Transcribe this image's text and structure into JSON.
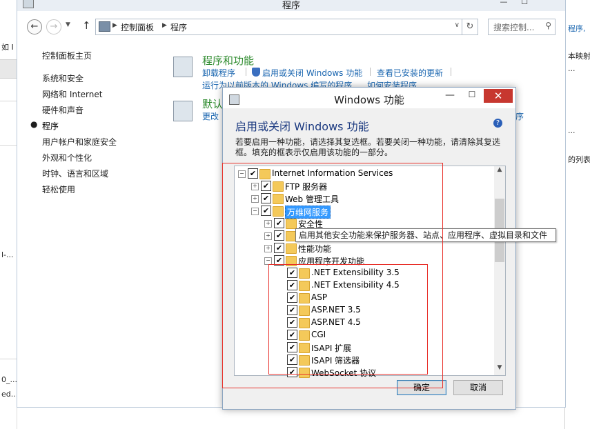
{
  "background_left": {
    "label_top": "如 I",
    "label_mid": "l-...",
    "label_low1": "0_...",
    "label_low2": "ed..."
  },
  "background_right": {
    "link1": "程序,",
    "text1": "本映射",
    "text2": "...",
    "text3": "的列表"
  },
  "control_panel": {
    "window_title": "程序",
    "address": {
      "crumbs": [
        "控制面板",
        "程序"
      ]
    },
    "search_placeholder": "搜索控制...",
    "sidebar": {
      "home": "控制面板主页",
      "items": [
        "系统和安全",
        "网络和 Internet",
        "硬件和声音",
        "程序",
        "用户帐户和家庭安全",
        "外观和个性化",
        "时钟、语言和区域",
        "轻松使用"
      ],
      "current_index": 3
    },
    "programs_section": {
      "title": "程序和功能",
      "links": [
        "卸载程序",
        "启用或关闭 Windows 功能",
        "查看已安装的更新"
      ],
      "link_row2": [
        "运行为以前版本的 Windows 编写的程序",
        "如何安装程序"
      ]
    },
    "default_section": {
      "title": "默认",
      "link": "更改",
      "right_fragment": "序"
    }
  },
  "dialog": {
    "title": "Windows 功能",
    "heading": "启用或关闭 Windows 功能",
    "description": "若要启用一种功能，请选择其复选框。若要关闭一种功能，请清除其复选框。填充的框表示仅启用该功能的一部分。",
    "tree": [
      {
        "label": "Internet Information Services",
        "level": 0,
        "expander": "−",
        "checked": true
      },
      {
        "label": "FTP 服务器",
        "level": 1,
        "expander": "+",
        "checked": true
      },
      {
        "label": "Web 管理工具",
        "level": 1,
        "expander": "+",
        "checked": true
      },
      {
        "label": "万维网服务",
        "level": 1,
        "expander": "−",
        "checked": true,
        "selected": true
      },
      {
        "label": "安全性",
        "level": 2,
        "expander": "+",
        "checked": true
      },
      {
        "label": "",
        "level": 2,
        "expander": "+",
        "checked": true
      },
      {
        "label": "性能功能",
        "level": 2,
        "expander": "+",
        "checked": true
      },
      {
        "label": "应用程序开发功能",
        "level": 2,
        "expander": "−",
        "checked": true
      },
      {
        "label": ".NET Extensibility 3.5",
        "level": 3,
        "checked": true
      },
      {
        "label": ".NET Extensibility 4.5",
        "level": 3,
        "checked": true
      },
      {
        "label": "ASP",
        "level": 3,
        "checked": true
      },
      {
        "label": "ASP.NET 3.5",
        "level": 3,
        "checked": true
      },
      {
        "label": "ASP.NET 4.5",
        "level": 3,
        "checked": true
      },
      {
        "label": "CGI",
        "level": 3,
        "checked": true
      },
      {
        "label": "ISAPI 扩展",
        "level": 3,
        "checked": true
      },
      {
        "label": "ISAPI 筛选器",
        "level": 3,
        "checked": true
      },
      {
        "label": "WebSocket 协议",
        "level": 3,
        "checked": true
      }
    ],
    "tooltip": "启用其他安全功能来保护服务器、站点、应用程序、虚拟目录和文件",
    "ok_label": "确定",
    "cancel_label": "取消",
    "checkmark": "✔",
    "close_glyph": "✕",
    "help_glyph": "?"
  },
  "colors": {
    "link": "#1a66b0",
    "section_title": "#2e8b2e",
    "dialog_heading": "#1c3a80",
    "selection": "#3399ff",
    "annotation_box": "#e8302a",
    "close_button": "#c7372f"
  }
}
